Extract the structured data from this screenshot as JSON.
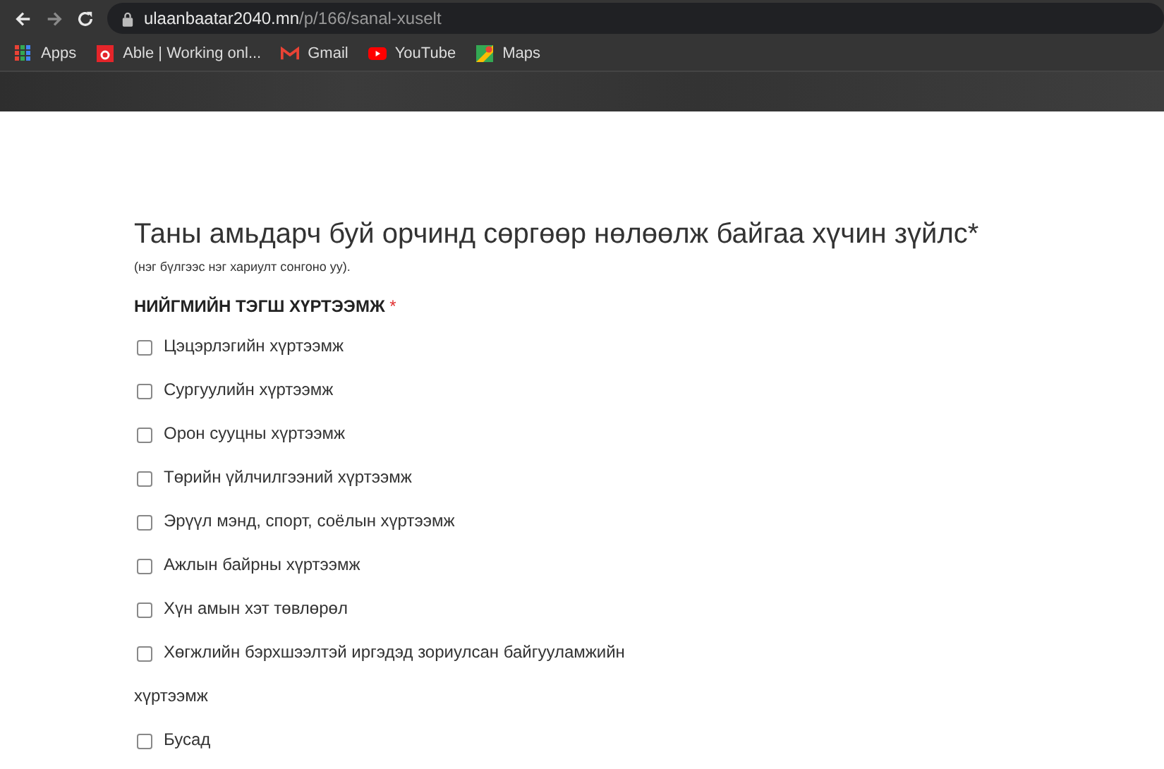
{
  "browser": {
    "url_host": "ulaanbaatar2040.mn",
    "url_path": "/p/166/sanal-xuselt",
    "bookmarks": [
      {
        "label": "Apps",
        "kind": "apps"
      },
      {
        "label": "Able | Working onl...",
        "kind": "able"
      },
      {
        "label": "Gmail",
        "kind": "gmail"
      },
      {
        "label": "YouTube",
        "kind": "youtube"
      },
      {
        "label": "Maps",
        "kind": "maps"
      }
    ]
  },
  "form": {
    "title": "Таны амьдарч буй орчинд сөргөөр нөлөөлж байгаа хүчин зүйлс*",
    "hint": "(нэг бүлгээс нэг хариулт сонгоно уу).",
    "group": {
      "label": "НИЙГМИЙН ТЭГШ ХҮРТЭЭМЖ",
      "required_mark": "*",
      "options": [
        {
          "label": "Цэцэрлэгийн хүртээмж",
          "checked": false
        },
        {
          "label": "Сургуулийн хүртээмж",
          "checked": false
        },
        {
          "label": "Орон сууцны хүртээмж",
          "checked": false
        },
        {
          "label": "Төрийн үйлчилгээний хүртээмж",
          "checked": false
        },
        {
          "label": "Эрүүл мэнд, спорт, соёлын хүртээмж",
          "checked": false
        },
        {
          "label": "Ажлын байрны хүртээмж",
          "checked": false
        },
        {
          "label": "Хүн амын хэт төвлөрөл",
          "checked": false
        },
        {
          "label": "Хөгжлийн бэрхшээлтэй иргэдэд зориулсан байгууламжийн хүртээмж",
          "checked": false
        },
        {
          "label": "Бусад",
          "checked": false
        }
      ]
    }
  }
}
